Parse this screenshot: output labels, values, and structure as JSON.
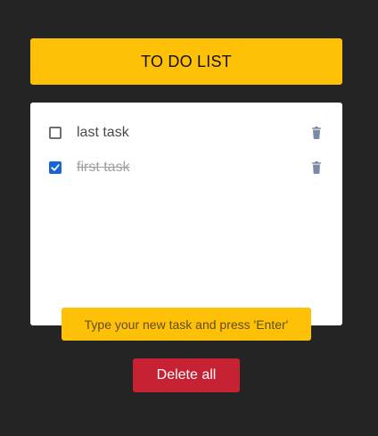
{
  "header": {
    "title": "TO DO LIST",
    "color": "#FFC107"
  },
  "tasks": [
    {
      "label": "last task",
      "completed": false,
      "checkbox_icon": "checkbox-empty-icon",
      "delete_icon": "trash-icon"
    },
    {
      "label": "first task",
      "completed": true,
      "checkbox_icon": "checkbox-checked-icon",
      "delete_icon": "trash-icon"
    }
  ],
  "new_task": {
    "placeholder": "Type your new task and press 'Enter'",
    "value": ""
  },
  "delete_all": {
    "label": "Delete all",
    "color": "#C62233"
  },
  "colors": {
    "background": "#242424",
    "card": "#FFFFFF",
    "checkbox_checked": "#1565D8",
    "trash_icon": "#7B88A6"
  }
}
